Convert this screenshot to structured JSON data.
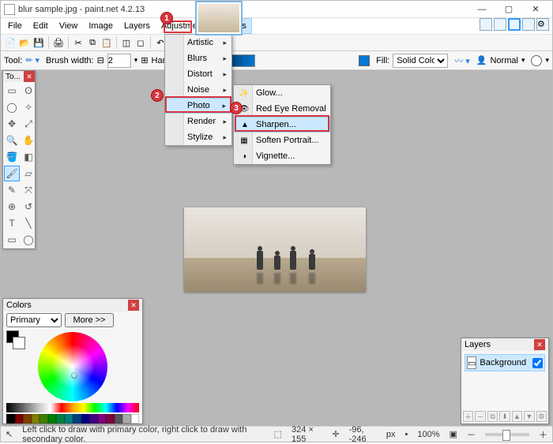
{
  "title": "blur sample.jpg - paint.net 4.2.13",
  "menus": [
    "File",
    "Edit",
    "View",
    "Image",
    "Layers",
    "Adjustments",
    "Effects"
  ],
  "toolopts": {
    "tool_label": "Tool:",
    "brush_label": "Brush width:",
    "brush_value": "2",
    "hardness_label": "Hardness",
    "fill_label": "Fill:",
    "fill_value": "Solid Color",
    "blend_value": "Normal"
  },
  "effects_menu": [
    "Artistic",
    "Blurs",
    "Distort",
    "Noise",
    "Photo",
    "Render",
    "Stylize"
  ],
  "photo_menu": [
    "Glow...",
    "Red Eye Removal",
    "Sharpen...",
    "Soften Portrait...",
    "Vignette..."
  ],
  "tools_title": "To...",
  "colors": {
    "title": "Colors",
    "primary": "Primary",
    "more": "More >>"
  },
  "layers": {
    "title": "Layers",
    "bg": "Background"
  },
  "status": {
    "hint": "Left click to draw with primary color, right click to draw with secondary color.",
    "dims": "324 × 155",
    "pos": "-96, -246",
    "unit": "px",
    "zoom": "100%"
  },
  "badges": {
    "b1": "1",
    "b2": "2",
    "b3": "3"
  }
}
